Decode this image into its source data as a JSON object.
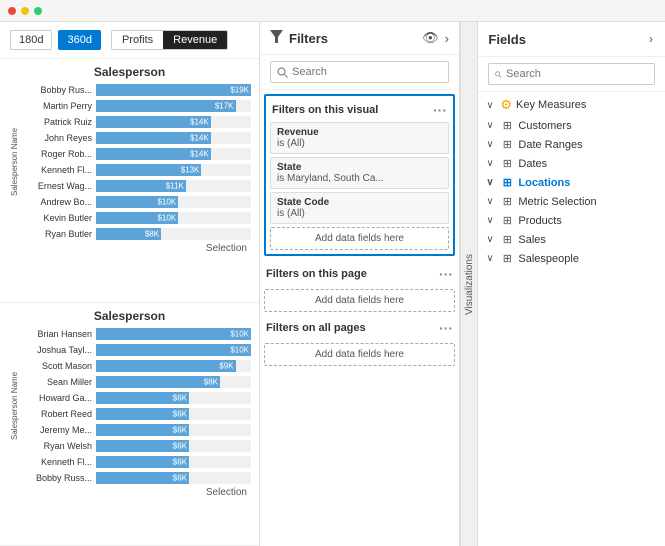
{
  "topbar": {
    "dots": [
      "red",
      "yellow",
      "green"
    ]
  },
  "left": {
    "time_buttons": [
      "180d",
      "360d"
    ],
    "active_time": "360d",
    "toggle_options": [
      "Profits",
      "Revenue"
    ],
    "active_toggle": "Revenue",
    "chart1": {
      "title": "Salesperson",
      "axis_label": "Salesperson Name",
      "bars": [
        {
          "label": "Bobby Rus...",
          "value": "$19K",
          "pct": 100
        },
        {
          "label": "Martin Perry",
          "value": "$17K",
          "pct": 90
        },
        {
          "label": "Patrick Ruiz",
          "value": "$14K",
          "pct": 74
        },
        {
          "label": "John Reyes",
          "value": "$14K",
          "pct": 74
        },
        {
          "label": "Roger Rob...",
          "value": "$14K",
          "pct": 74
        },
        {
          "label": "Kenneth Fl...",
          "value": "$13K",
          "pct": 68
        },
        {
          "label": "Ernest Wag...",
          "value": "$11K",
          "pct": 58
        },
        {
          "label": "Andrew Bo...",
          "value": "$10K",
          "pct": 53
        },
        {
          "label": "Kevin Butler",
          "value": "$10K",
          "pct": 53
        },
        {
          "label": "Ryan Butler",
          "value": "$8K",
          "pct": 42
        }
      ],
      "selection_label": "Selection"
    },
    "chart2": {
      "title": "Salesperson",
      "axis_label": "Salesperson Name",
      "bars": [
        {
          "label": "Brian Hansen",
          "value": "$10K",
          "pct": 100
        },
        {
          "label": "Joshua Tayl...",
          "value": "$10K",
          "pct": 100
        },
        {
          "label": "Scott Mason",
          "value": "$9K",
          "pct": 90
        },
        {
          "label": "Sean Miller",
          "value": "$8K",
          "pct": 80
        },
        {
          "label": "Howard Ga...",
          "value": "$6K",
          "pct": 60
        },
        {
          "label": "Robert Reed",
          "value": "$6K",
          "pct": 60
        },
        {
          "label": "Jeremy Me...",
          "value": "$6K",
          "pct": 60
        },
        {
          "label": "Ryan Welsh",
          "value": "$6K",
          "pct": 60
        },
        {
          "label": "Kenneth Fl...",
          "value": "$6K",
          "pct": 60
        },
        {
          "label": "Bobby Russ...",
          "value": "$6K",
          "pct": 60
        }
      ],
      "selection_label": "Selection"
    }
  },
  "filters": {
    "title": "Filters",
    "search_placeholder": "Search",
    "visual_section": {
      "header": "Filters on this visual",
      "items": [
        {
          "name": "Revenue",
          "value": "is (All)"
        },
        {
          "name": "State",
          "value": "is Maryland, South Ca..."
        },
        {
          "name": "State Code",
          "value": "is (All)"
        }
      ],
      "add_button": "Add data fields here"
    },
    "page_section": {
      "header": "Filters on this page",
      "add_button": "Add data fields here"
    },
    "all_section": {
      "header": "Filters on all pages",
      "add_button": "Add data fields here"
    }
  },
  "fields": {
    "title": "Fields",
    "search_placeholder": "Search",
    "viz_tab_label": "Visualizations",
    "groups": [
      {
        "label": "Key Measures",
        "expanded": true,
        "icon": "table",
        "special": "yellow"
      },
      {
        "label": "Customers",
        "expanded": false,
        "icon": "table",
        "bold": false
      },
      {
        "label": "Date Ranges",
        "expanded": false,
        "icon": "table",
        "bold": false
      },
      {
        "label": "Dates",
        "expanded": false,
        "icon": "table",
        "bold": false
      },
      {
        "label": "Locations",
        "expanded": true,
        "icon": "table",
        "bold": true
      },
      {
        "label": "Metric Selection",
        "expanded": false,
        "icon": "table",
        "bold": false
      },
      {
        "label": "Products",
        "expanded": false,
        "icon": "table",
        "bold": false
      },
      {
        "label": "Sales",
        "expanded": false,
        "icon": "table",
        "bold": false
      },
      {
        "label": "Salespeople",
        "expanded": false,
        "icon": "table",
        "bold": false
      }
    ]
  }
}
